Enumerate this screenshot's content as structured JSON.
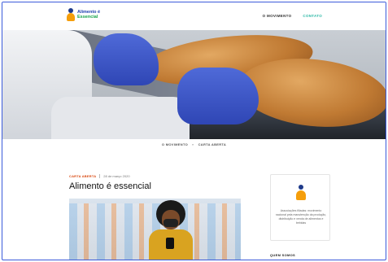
{
  "brand": {
    "line1": "Alimento é",
    "line2": "Essencial"
  },
  "nav": {
    "items": [
      {
        "label": "O MOVIMENTO",
        "active": false
      },
      {
        "label": "CONTATO",
        "active": true
      }
    ]
  },
  "breadcrumb": {
    "items": [
      "O MOVIMENTO",
      "CARTA ABERTA"
    ],
    "separator": "»"
  },
  "article": {
    "category": "CARTA ABERTA",
    "date": "28 de março 2020",
    "title": "Alimento é essencial"
  },
  "sidebar": {
    "card_text": "Associações filiadas: movimento nacional pela manutenção da produção, distribuição e venda de alimentos e bebidas",
    "section_title": "QUEM SOMOS"
  },
  "colors": {
    "accent": "#2bb8a6",
    "category": "#d9480f",
    "brand_blue": "#1e40af",
    "brand_green": "#16a34a"
  }
}
